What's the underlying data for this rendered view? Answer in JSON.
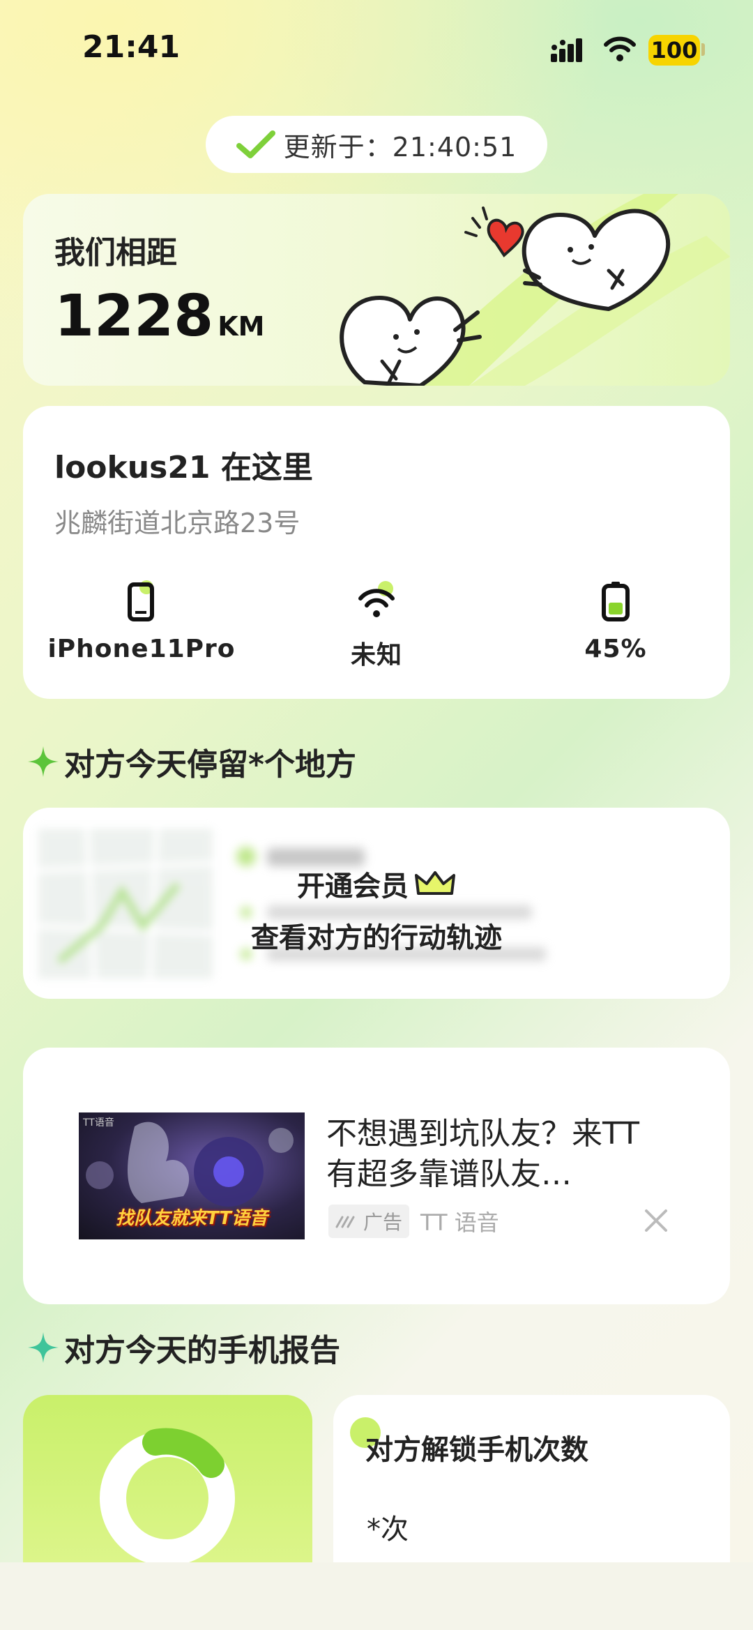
{
  "status_bar": {
    "time": "21:41",
    "battery": "100"
  },
  "update": {
    "label": "更新于：21:40:51"
  },
  "distance": {
    "label": "我们相距",
    "value": "1228",
    "unit": "KM"
  },
  "location": {
    "title": "lookus21 在这里",
    "address": "兆麟街道北京路23号",
    "stats": [
      {
        "label": "iPhone11Pro",
        "icon": "phone-icon"
      },
      {
        "label": "未知",
        "icon": "wifi-icon"
      },
      {
        "label": "45%",
        "icon": "battery-icon"
      }
    ]
  },
  "section_places": {
    "title": "对方今天停留*个地方"
  },
  "track": {
    "vip_line1": "开通会员",
    "vip_line2": "查看对方的行动轨迹"
  },
  "ad": {
    "title": "不想遇到坑队友？来TT 有超多靠谱队友…",
    "image_caption": "找队友就来TT语音",
    "image_logo": "TT语音",
    "badge": "广告",
    "source": "TT 语音"
  },
  "section_report": {
    "title": "对方今天的手机报告"
  },
  "report": {
    "title": "对方解锁手机次数",
    "count": "*次"
  },
  "colors": {
    "accent_green": "#8ad42c",
    "light_green": "#c9f06a",
    "heart_red": "#e8392f",
    "battery_yellow": "#f7d400"
  }
}
